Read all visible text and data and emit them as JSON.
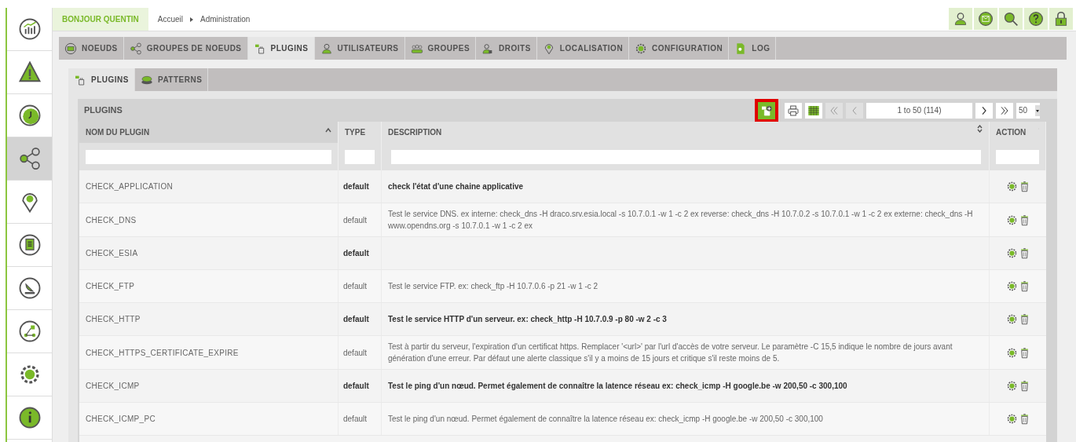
{
  "sidebar": {
    "items": [
      {
        "kind": "chart",
        "selected": false
      },
      {
        "kind": "warning",
        "selected": false
      },
      {
        "kind": "clock",
        "selected": false
      },
      {
        "kind": "share",
        "selected": true
      },
      {
        "kind": "pin",
        "selected": false
      },
      {
        "kind": "book",
        "selected": false
      },
      {
        "kind": "satellite",
        "selected": false
      },
      {
        "kind": "flow",
        "selected": false
      },
      {
        "kind": "gear",
        "selected": false
      },
      {
        "kind": "info",
        "selected": false
      }
    ]
  },
  "topbar": {
    "greeting": "BONJOUR QUENTIN",
    "breadcrumb": [
      "Accueil",
      "Administration"
    ],
    "actions": [
      {
        "kind": "user"
      },
      {
        "kind": "mail"
      },
      {
        "kind": "search"
      },
      {
        "kind": "help"
      },
      {
        "kind": "lock"
      }
    ]
  },
  "tabs": [
    {
      "label": "NOEUDS",
      "kind": "monitor",
      "selected": false
    },
    {
      "label": "GROUPES DE NOEUDS",
      "kind": "share",
      "selected": false
    },
    {
      "label": "PLUGINS",
      "kind": "plugin",
      "selected": true
    },
    {
      "label": "UTILISATEURS",
      "kind": "user",
      "selected": false
    },
    {
      "label": "GROUPES",
      "kind": "users",
      "selected": false
    },
    {
      "label": "DROITS",
      "kind": "userlock",
      "selected": false
    },
    {
      "label": "LOCALISATION",
      "kind": "pin",
      "selected": false
    },
    {
      "label": "CONFIGURATION",
      "kind": "gear",
      "selected": false
    },
    {
      "label": "LOG",
      "kind": "file",
      "selected": false
    }
  ],
  "subtabs": [
    {
      "label": "PLUGINS",
      "kind": "plugin",
      "selected": true
    },
    {
      "label": "PATTERNS",
      "kind": "patterns",
      "selected": false
    }
  ],
  "panel": {
    "title": "PLUGINS",
    "add_button_highlighted": true,
    "page_info": "1 to 50 (114)",
    "page_size": "50"
  },
  "table": {
    "columns": [
      {
        "label": "NOM DU PLUGIN",
        "sorted": true
      },
      {
        "label": "TYPE",
        "sorted": false
      },
      {
        "label": "DESCRIPTION",
        "sorted": false
      },
      {
        "label": "ACTION",
        "sorted": false
      }
    ],
    "rows": [
      {
        "name": "CHECK_APPLICATION",
        "type": "default",
        "description": "check l'état d'une chaine applicative",
        "bold": true
      },
      {
        "name": "CHECK_DNS",
        "type": "default",
        "description": "Test le service DNS. ex interne: check_dns -H draco.srv.esia.local -s 10.7.0.1 -w 1 -c 2 ex reverse: check_dns -H 10.7.0.2 -s 10.7.0.1 -w 1 -c 2 ex externe: check_dns -H www.opendns.org -s 10.7.0.1 -w 1 -c 2 ex",
        "bold": false
      },
      {
        "name": "CHECK_ESIA",
        "type": "default",
        "bold": true
      },
      {
        "name": "CHECK_FTP",
        "type": "default",
        "description": "Test le service FTP. ex: check_ftp -H 10.7.0.6 -p 21 -w 1 -c 2",
        "bold": false
      },
      {
        "name": "CHECK_HTTP",
        "type": "default",
        "description": "Test le service HTTP d'un serveur. ex: check_http -H 10.7.0.9 -p 80 -w 2 -c 3",
        "bold": true
      },
      {
        "name": "CHECK_HTTPS_CERTIFICATE_EXPIRE",
        "type": "default",
        "description": "Test à partir du serveur, l'expiration d'un certificat https. Remplacer '<url>' par l'url d'accès de votre serveur. Le paramètre -C 15,5 indique le nombre de jours avant génération d'une erreur. Par défaut une alerte classique s'il y a moins de 15 jours et critique s'il reste moins de 5.",
        "bold": false
      },
      {
        "name": "CHECK_ICMP",
        "type": "default",
        "description": "Test le ping d'un nœud. Permet également de connaître la latence réseau ex: check_icmp -H google.be -w 200,50 -c 300,100",
        "bold": true
      },
      {
        "name": "CHECK_ICMP_PC",
        "type": "default",
        "description": "Test le ping d'un nœud. Permet également de connaître la latence réseau ex: check_icmp -H google.be -w 200,50 -c 300,100",
        "bold": false
      }
    ]
  }
}
